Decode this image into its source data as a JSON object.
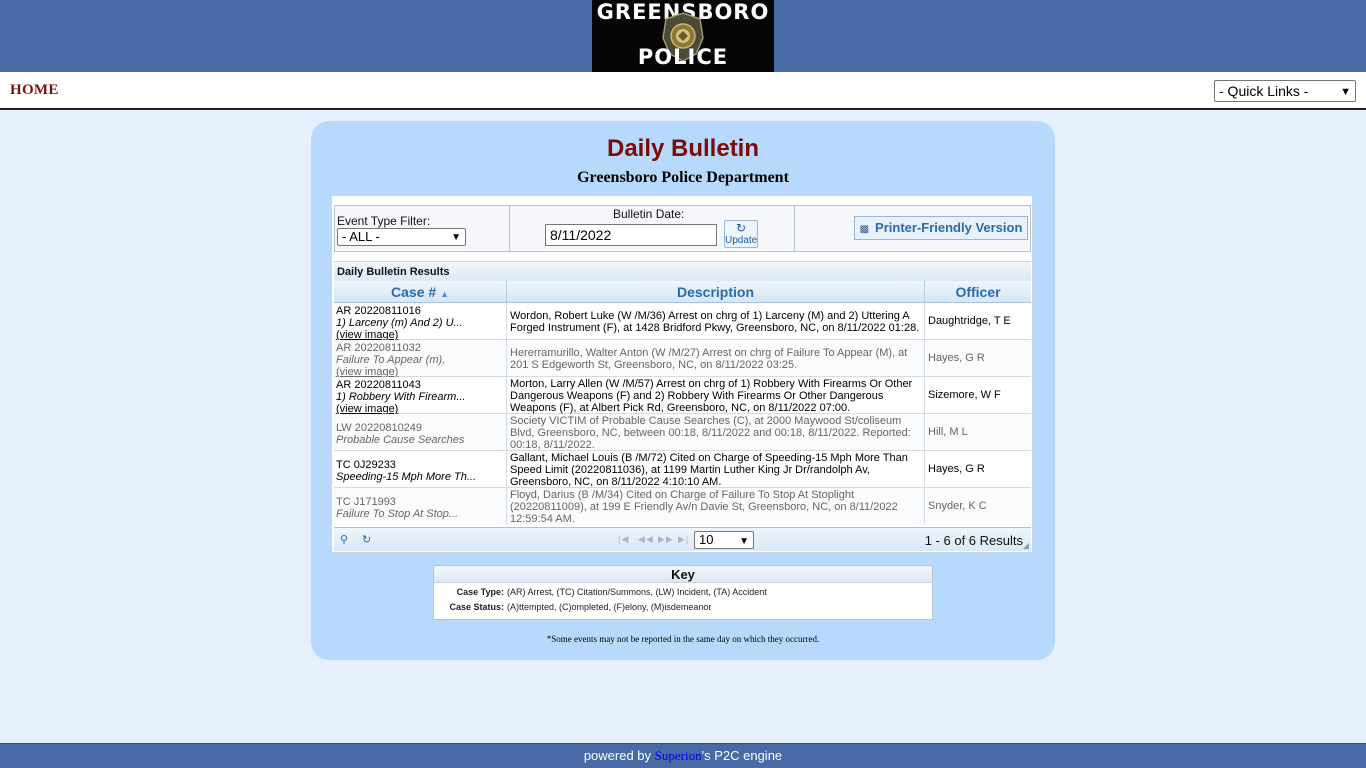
{
  "logo": {
    "line1": "GREENSBORO",
    "line2": "POLICE"
  },
  "nav": {
    "home_label": "HOME",
    "quick_links": "- Quick Links -"
  },
  "bulletin": {
    "title": "Daily Bulletin",
    "subtitle": "Greensboro Police Department",
    "event_filter_label": "Event Type Filter:",
    "event_filter_value": "- ALL -",
    "date_label": "Bulletin Date:",
    "date_value": "8/11/2022",
    "update_label": "Update",
    "printer_label": "Printer-Friendly Version",
    "results_caption": "Daily Bulletin Results",
    "columns": [
      "Case #",
      "Description",
      "Officer"
    ],
    "rows": [
      {
        "case": "AR 20220811016",
        "sub": "1) Larceny (m) And 2) U...",
        "view": "(view image)",
        "desc": "Wordon, Robert Luke (W /M/36) Arrest on chrg of 1) Larceny (M) and 2) Uttering A Forged Instrument (F), at 1428 Bridford Pkwy, Greensboro, NC, on 8/11/2022 01:28.",
        "officer": "Daughtridge, T E"
      },
      {
        "case": "AR 20220811032",
        "sub": "Failure To Appear (m),",
        "view": "(view image)",
        "desc": "Hererramurillo, Walter Anton (W /M/27) Arrest on chrg of Failure To Appear (M), at 201 S Edgeworth St, Greensboro, NC, on 8/11/2022 03:25.",
        "officer": "Hayes, G R"
      },
      {
        "case": "AR 20220811043",
        "sub": "1) Robbery With Firearm...",
        "view": "(view image)",
        "desc": "Morton, Larry Allen (W /M/57) Arrest on chrg of 1) Robbery With Firearms Or Other Dangerous Weapons (F) and 2) Robbery With Firearms Or Other Dangerous Weapons (F), at Albert Pick Rd, Greensboro, NC, on 8/11/2022 07:00.",
        "officer": "Sizemore, W F"
      },
      {
        "case": "LW 20220810249",
        "sub": "Probable Cause Searches",
        "view": "",
        "desc": "Society VICTIM of Probable Cause Searches (C), at 2000 Maywood St/coliseum Blvd, Greensboro, NC, between 00:18, 8/11/2022 and 00:18, 8/11/2022. Reported: 00:18, 8/11/2022.",
        "officer": "Hill, M L"
      },
      {
        "case": "TC 0J29233",
        "sub": "Speeding-15 Mph More Th...",
        "view": "",
        "desc": "Gallant, Michael Louis (B /M/72) Cited on Charge of Speeding-15 Mph More Than Speed Limit (20220811036), at 1199 Martin Luther King Jr Dr/randolph Av, Greensboro, NC, on 8/11/2022 4:10:10 AM.",
        "officer": "Hayes, G R"
      },
      {
        "case": "TC J171993",
        "sub": "Failure To Stop At Stop...",
        "view": "",
        "desc": "Floyd, Darius (B /M/34) Cited on Charge of Failure To Stop At Stoplight (20220811009), at 199 E Friendly Av/n Davie St, Greensboro, NC, on 8/11/2022 12:59:54 AM.",
        "officer": "Snyder, K C"
      }
    ],
    "page_size": "10",
    "result_count": "1 - 6 of 6 Results"
  },
  "key": {
    "title": "Key",
    "case_type_label": "Case Type:",
    "case_type_text": "(AR) Arrest, (TC) Citation/Summons, (LW) Incident, (TA) Accident",
    "case_status_label": "Case Status:",
    "case_status_text": "(A)ttempted, (C)ompleted, (F)elony, (M)isdemeanor"
  },
  "footnote": "*Some events may not be reported in the same day on which they occurred.",
  "footer": {
    "prefix": "powered by",
    "link": "Superion",
    "suffix": "'s P2C engine"
  },
  "colors": {
    "banner": "#4a6aa5",
    "title": "#7b0b0b",
    "panel": "#b6d9fc",
    "background": "#e5f0fc"
  }
}
